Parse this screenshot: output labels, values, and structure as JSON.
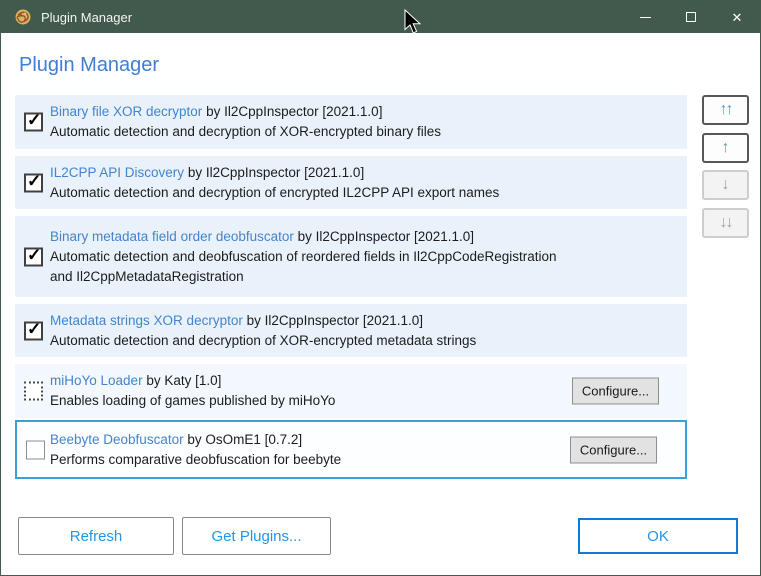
{
  "titlebar": {
    "app_title": "Plugin Manager",
    "close_glyph": "✕"
  },
  "header": {
    "title": "Plugin Manager"
  },
  "list": {
    "check_glyph": "✓",
    "plugins": [
      {
        "name": "Binary file XOR decryptor",
        "by": "by Il2CppInspector [2021.1.0]",
        "description": "Automatic detection and decryption of XOR-encrypted binary files",
        "checkbox": "checked"
      },
      {
        "name": "IL2CPP API Discovery",
        "by": "by Il2CppInspector [2021.1.0]",
        "description": "Automatic detection and decryption of encrypted IL2CPP API export names",
        "checkbox": "checked"
      },
      {
        "name": "Binary metadata field order deobfuscator",
        "by": "by Il2CppInspector [2021.1.0]",
        "description": "Automatic detection and deobfuscation of reordered fields in Il2CppCodeRegistration and Il2CppMetadataRegistration",
        "checkbox": "checked"
      },
      {
        "name": "Metadata strings XOR decryptor",
        "by": "by Il2CppInspector [2021.1.0]",
        "description": "Automatic detection and decryption of XOR-encrypted metadata strings",
        "checkbox": "checked"
      },
      {
        "name": "miHoYo Loader",
        "by": "by Katy [1.0]",
        "description": "Enables loading of games published by miHoYo",
        "checkbox": "dotted",
        "configure_label": "Configure..."
      },
      {
        "name": "Beebyte Deobfuscator",
        "by": "by OsOmE1 [0.7.2]",
        "description": "Performs comparative deobfuscation for beebyte",
        "checkbox": "unchecked",
        "selected": "true",
        "configure_label": "Configure..."
      }
    ]
  },
  "reorder": {
    "move_to_top": "↑↑",
    "move_up": "↑",
    "move_down": "↓",
    "move_to_bottom": "↓↓"
  },
  "footer": {
    "refresh": "Refresh",
    "get_plugins": "Get Plugins...",
    "ok": "OK"
  },
  "colors": {
    "titlebar": "#42594d",
    "heading_blue": "#3f7ed3",
    "link_blue": "#4384cb",
    "row_background": "#e9f2fb",
    "selection_border": "#3aa0da",
    "ok_border": "#0f7ad8",
    "footer_text_blue": "#2196e8"
  }
}
